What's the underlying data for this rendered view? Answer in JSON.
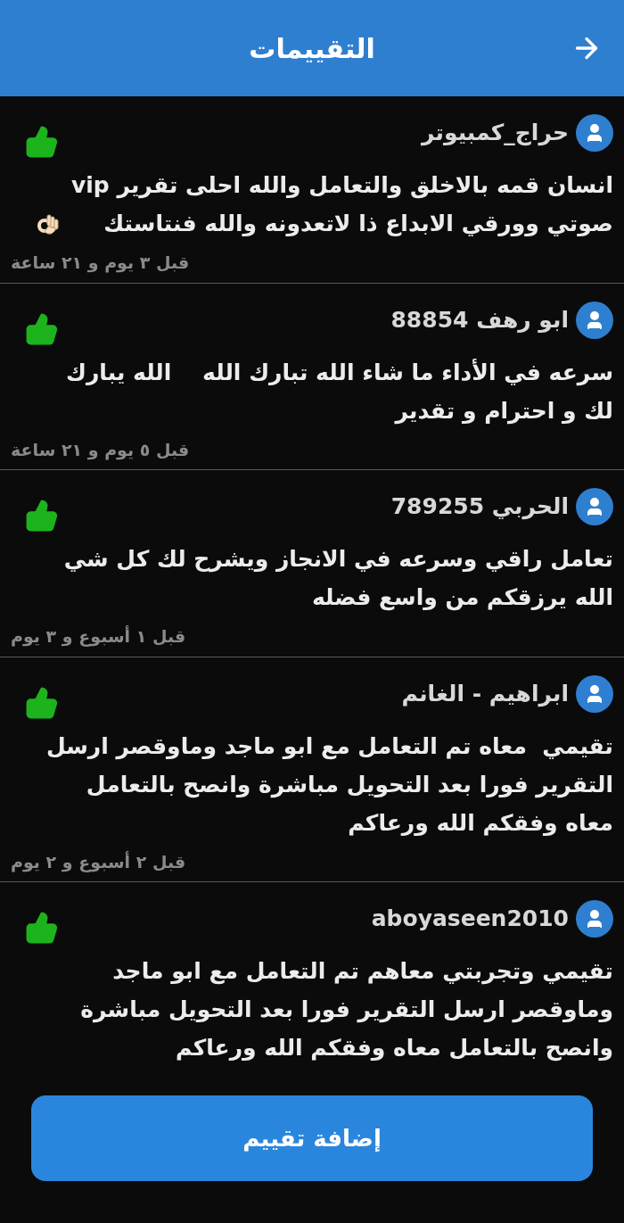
{
  "header": {
    "title": "التقييمات"
  },
  "reviews": [
    {
      "user": "حراج_كمبيوتر",
      "positive": true,
      "ok_hand": true,
      "text": "انسان قمه بالاخلق والتعامل والله احلى تقرير vip\nصوتي وورقي الابداع ذا لاتعدونه والله فنتاستك",
      "time": "قبل ٣ يوم و ٢١ ساعة"
    },
    {
      "user": "ابو رهف 88854",
      "positive": true,
      "ok_hand": false,
      "text": "سرعه في الأداء ما شاء الله تبارك الله    الله يبارك\nلك و احترام و تقدير",
      "time": "قبل ٥ يوم و ٢١ ساعة"
    },
    {
      "user": "الحربي 789255",
      "positive": true,
      "ok_hand": false,
      "text": "تعامل راقي وسرعه في الانجاز ويشرح لك كل شي\nالله يرزقكم من واسع فضله",
      "time": "قبل ١ أسبوع و ٣ يوم"
    },
    {
      "user": "ابراهيم - الغانم",
      "positive": true,
      "ok_hand": false,
      "text": "تقيمي  معاه تم التعامل مع ابو ماجد وماوقصر ارسل\nالتقرير فورا بعد التحويل مباشرة وانصح بالتعامل\nمعاه وفقكم الله ورعاكم",
      "time": "قبل ٢ أسبوع و ٢ يوم"
    },
    {
      "user": "aboyaseen2010",
      "positive": true,
      "ok_hand": false,
      "text": "تقيمي وتجربتي معاهم تم التعامل مع ابو ماجد\nوماوقصر ارسل التقرير فورا بعد التحويل مباشرة\nوانصح بالتعامل معاه وفقكم الله ورعاكم"
    }
  ],
  "add_button": {
    "label": "إضافة تقييم"
  }
}
